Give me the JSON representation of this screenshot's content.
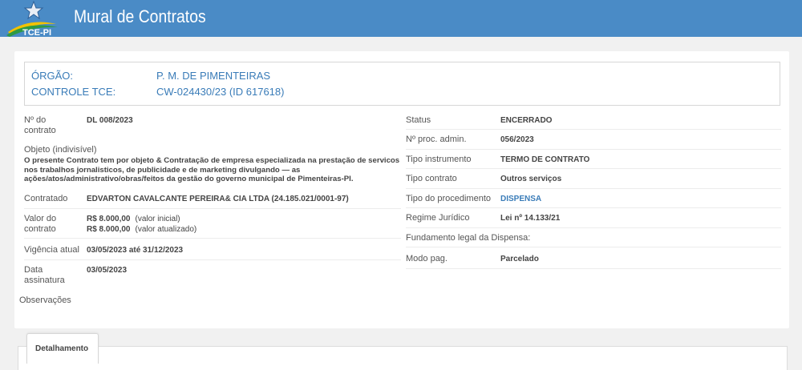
{
  "header": {
    "title": "Mural de Contratos",
    "logo_text": "TCE-PI"
  },
  "summary": {
    "orgao_label": "ÓRGÃO:",
    "orgao_value": "P. M. DE PIMENTEIRAS",
    "controle_label": "CONTROLE TCE:",
    "controle_value": "CW-024430/23 (ID 617618)"
  },
  "left": {
    "numero_label": "Nº do\ncontrato",
    "numero_value": "DL 008/2023",
    "objeto_label": "Objeto (indivisível)",
    "objeto_value": "O presente Contrato tem por objeto & Contratação de empresa especializada na prestação de servicos nos trabalhos jornalisticos, de publicidade e de marketing divulgando — as ações/atos/administrativo/obras/feitos da gestão do governo municipal de Pimenteiras-PI.",
    "contratado_label": "Contratado",
    "contratado_value": "EDVARTON CAVALCANTE PEREIRA& CIA LTDA (24.185.021/0001-97)",
    "valor_label": "Valor do\ncontrato",
    "valor_inicial": "R$ 8.000,00",
    "valor_inicial_note": "(valor inicial)",
    "valor_atualizado": "R$ 8.000,00",
    "valor_atualizado_note": "(valor atualizado)",
    "vigencia_label": "Vigência atual",
    "vigencia_value": "03/05/2023 até 31/12/2023",
    "assinatura_label": "Data\nassinatura",
    "assinatura_value": "03/05/2023",
    "observacoes_label": "Observações"
  },
  "right": {
    "status_label": "Status",
    "status_value": "ENCERRADO",
    "proc_label": "Nº proc. admin.",
    "proc_value": "056/2023",
    "tipo_instr_label": "Tipo instrumento",
    "tipo_instr_value": "TERMO DE CONTRATO",
    "tipo_contrato_label": "Tipo contrato",
    "tipo_contrato_value": "Outros serviços",
    "tipo_proc_label": "Tipo do procedimento",
    "tipo_proc_value": "DISPENSA",
    "regime_label": "Regime Jurídico",
    "regime_value": "Lei nº 14.133/21",
    "fundamento_label": "Fundamento legal da Dispensa:",
    "modo_label": "Modo pag.",
    "modo_value": "Parcelado"
  },
  "tabs": {
    "detalhamento": "Detalhamento"
  },
  "colors": {
    "topbar": "#4a8bc6",
    "link": "#3a7cb8"
  }
}
